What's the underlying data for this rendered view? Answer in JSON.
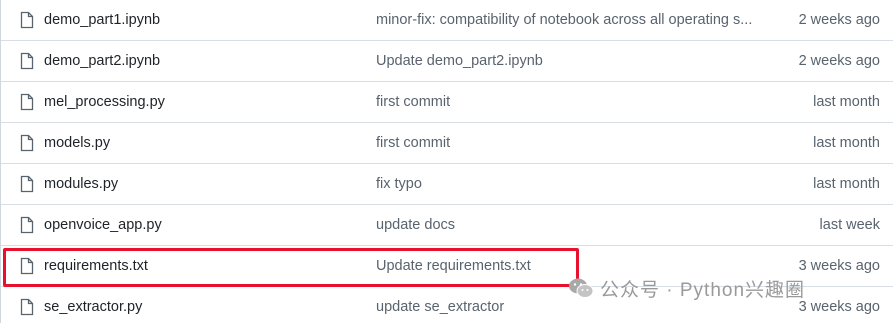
{
  "files": [
    {
      "name": "demo_part1.ipynb",
      "commit": "minor-fix: compatibility of notebook across all operating s...",
      "age": "2 weeks ago"
    },
    {
      "name": "demo_part2.ipynb",
      "commit": "Update demo_part2.ipynb",
      "age": "2 weeks ago"
    },
    {
      "name": "mel_processing.py",
      "commit": "first commit",
      "age": "last month"
    },
    {
      "name": "models.py",
      "commit": "first commit",
      "age": "last month"
    },
    {
      "name": "modules.py",
      "commit": "fix typo",
      "age": "last month"
    },
    {
      "name": "openvoice_app.py",
      "commit": "update docs",
      "age": "last week"
    },
    {
      "name": "requirements.txt",
      "commit": "Update requirements.txt",
      "age": "3 weeks ago"
    },
    {
      "name": "se_extractor.py",
      "commit": "update se_extractor",
      "age": "3 weeks ago"
    }
  ],
  "highlighted_file": "requirements.txt",
  "highlight_color": "#e8112d",
  "file_icon": "file-icon",
  "watermark": {
    "text": "公众号 · Python兴趣圈",
    "logo": "wechat-logo"
  }
}
